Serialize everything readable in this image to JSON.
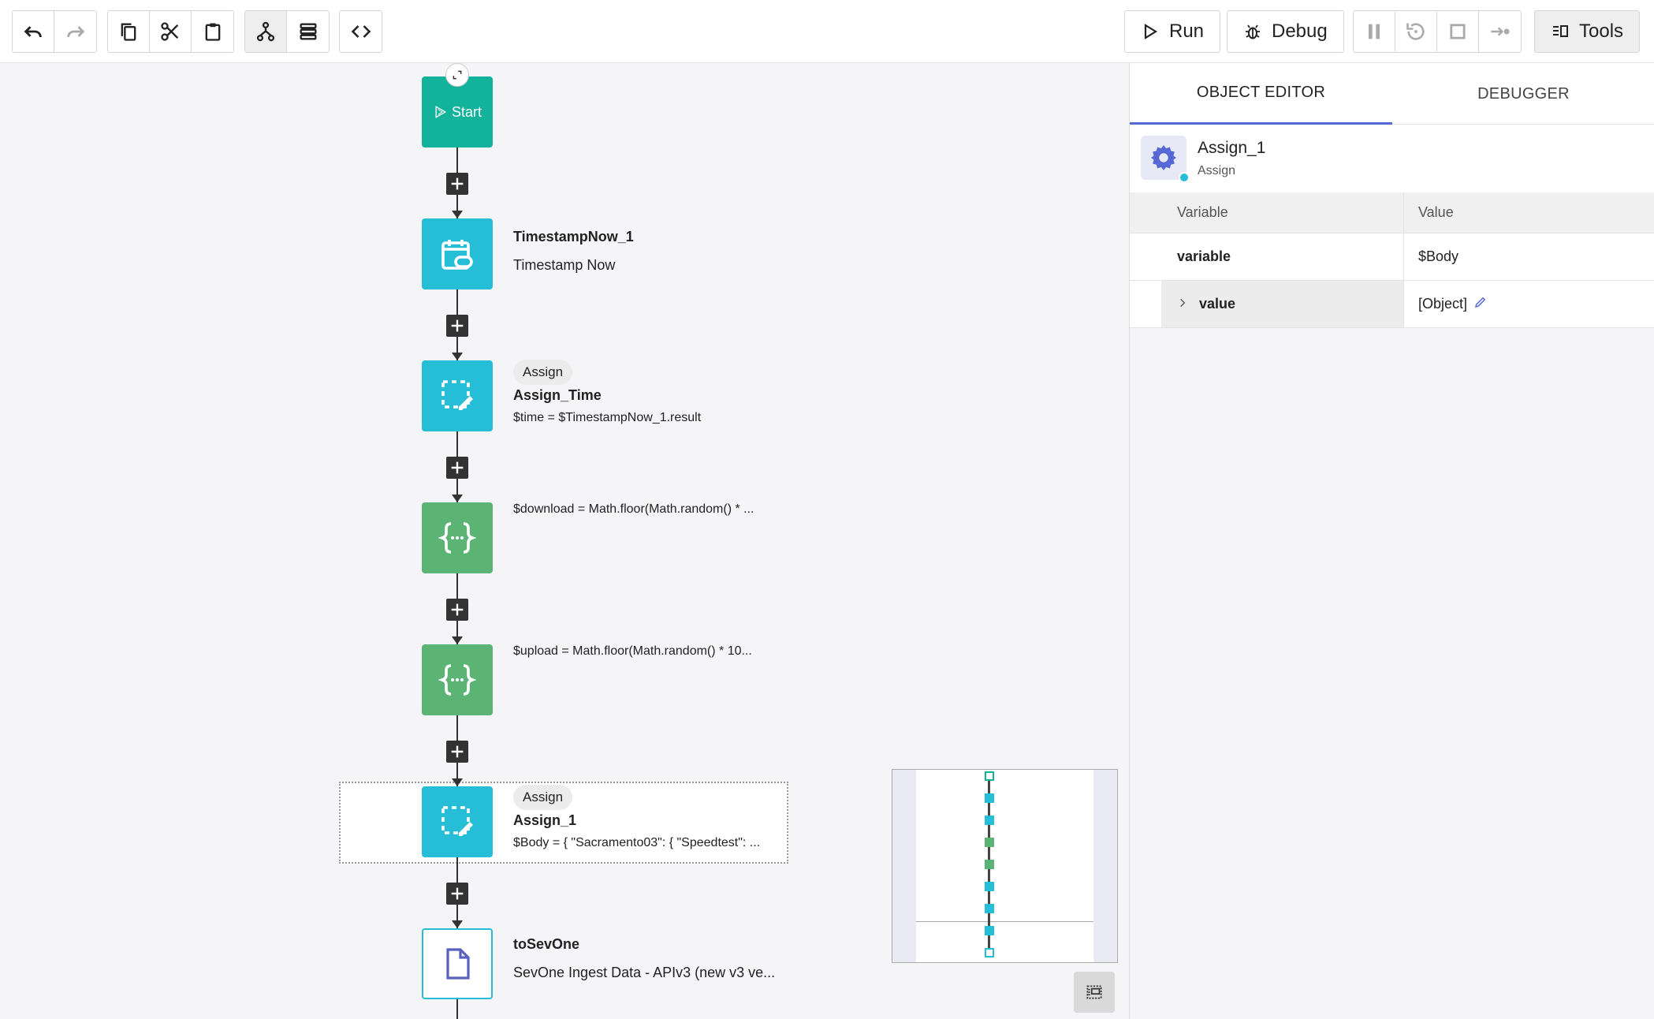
{
  "toolbar": {
    "run_label": "Run",
    "debug_label": "Debug",
    "tools_label": "Tools"
  },
  "flow": {
    "start_label": "Start",
    "nodes": [
      {
        "title": "TimestampNow_1",
        "subtitle": "Timestamp Now"
      },
      {
        "tag": "Assign",
        "title": "Assign_Time",
        "code": "$time = $TimestampNow_1.result"
      },
      {
        "code": "$download = Math.floor(Math.random() * ..."
      },
      {
        "code": "$upload = Math.floor(Math.random() * 10..."
      },
      {
        "tag": "Assign",
        "title": "Assign_1",
        "code": "$Body = { \"Sacramento03\": { \"Speedtest\": ..."
      },
      {
        "title": "toSevOne",
        "subtitle": "SevOne Ingest Data - APIv3 (new v3 ve..."
      }
    ]
  },
  "panel": {
    "tabs": [
      "OBJECT EDITOR",
      "DEBUGGER"
    ],
    "object_name": "Assign_1",
    "object_type": "Assign",
    "table": {
      "col_variable": "Variable",
      "col_value": "Value",
      "rows": [
        {
          "variable": "variable",
          "value": "$Body"
        },
        {
          "variable": "value",
          "value": "[Object]"
        }
      ]
    }
  },
  "colors": {
    "start": "#12b39a",
    "action": "#26bdd6",
    "script": "#5bb374",
    "accent": "#5568d6"
  }
}
